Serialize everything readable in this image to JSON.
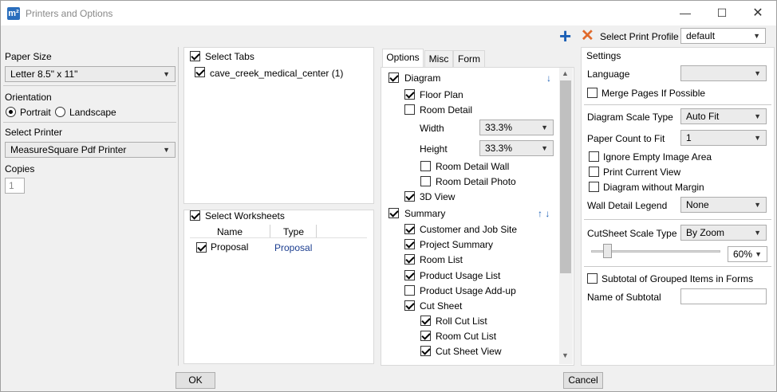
{
  "window": {
    "title": "Printers and Options",
    "app_icon": "m²"
  },
  "toolbar": {
    "print_profile_label": "Select Print Profile",
    "print_profile_value": "default"
  },
  "left": {
    "paper_size_label": "Paper Size",
    "paper_size_value": "Letter 8.5\" x 11\"",
    "orientation_label": "Orientation",
    "portrait_label": "Portrait",
    "landscape_label": "Landscape",
    "select_printer_label": "Select Printer",
    "printer_value": "MeasureSquare Pdf Printer",
    "copies_label": "Copies",
    "copies_value": "1"
  },
  "tabs_panel": {
    "select_tabs_label": "Select Tabs",
    "tab_item": "cave_creek_medical_center (1)",
    "select_worksheets_label": "Select Worksheets",
    "col_name": "Name",
    "col_type": "Type",
    "row_name": "Proposal",
    "row_type": "Proposal"
  },
  "options_tabs": [
    "Options",
    "Misc",
    "Form"
  ],
  "options": {
    "diagram": "Diagram",
    "floor_plan": "Floor Plan",
    "room_detail": "Room Detail",
    "width_label": "Width",
    "width_value": "33.3%",
    "height_label": "Height",
    "height_value": "33.3%",
    "room_detail_wall": "Room Detail Wall",
    "room_detail_photo": "Room Detail Photo",
    "view_3d": "3D View",
    "summary": "Summary",
    "customer_job_site": "Customer and Job Site",
    "project_summary": "Project Summary",
    "room_list": "Room List",
    "product_usage_list": "Product Usage List",
    "product_usage_addup": "Product Usage Add-up",
    "cut_sheet": "Cut Sheet",
    "roll_cut_list": "Roll Cut List",
    "room_cut_list": "Room Cut List",
    "cut_sheet_view": "Cut Sheet View",
    "arrow_down": "↓",
    "arrows_updown": "↑ ↓"
  },
  "settings": {
    "title": "Settings",
    "language_label": "Language",
    "language_value": "",
    "merge_pages": "Merge Pages If Possible",
    "diagram_scale_type_label": "Diagram Scale Type",
    "diagram_scale_type_value": "Auto Fit",
    "paper_count_label": "Paper Count to Fit",
    "paper_count_value": "1",
    "ignore_empty": "Ignore Empty Image Area",
    "print_current_view": "Print Current View",
    "diagram_without_margin": "Diagram without Margin",
    "wall_detail_legend_label": "Wall Detail Legend",
    "wall_detail_legend_value": "None",
    "cutsheet_scale_label": "CutSheet Scale Type",
    "cutsheet_scale_value": "By Zoom",
    "zoom_value": "60%",
    "zoom_slider_level": 0.1,
    "subtotal_grouped": "Subtotal of Grouped Items in Forms",
    "name_of_subtotal_label": "Name of Subtotal",
    "name_of_subtotal_value": ""
  },
  "buttons": {
    "ok": "OK",
    "cancel": "Cancel"
  },
  "icons": {
    "add": "plus-icon",
    "remove": "x-icon"
  },
  "colors": {
    "accent_blue": "#1b5fb5",
    "remove_orange": "#e06a2c"
  }
}
